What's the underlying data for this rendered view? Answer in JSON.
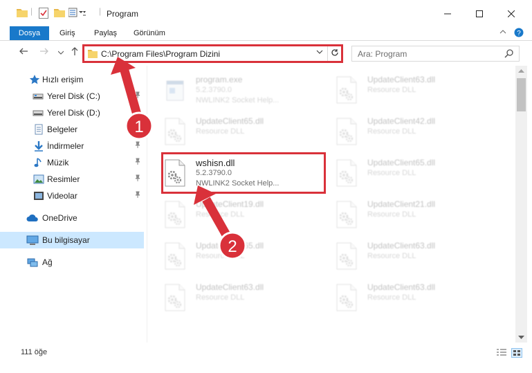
{
  "window": {
    "title": "Program",
    "minimize_icon": "minimize-icon",
    "maximize_icon": "maximize-icon",
    "close_icon": "close-icon"
  },
  "ribbon": {
    "tabs": [
      {
        "label": "Dosya",
        "active": true
      },
      {
        "label": "Giriş",
        "active": false
      },
      {
        "label": "Paylaş",
        "active": false
      },
      {
        "label": "Görünüm",
        "active": false
      }
    ],
    "accent": "#1979ca"
  },
  "nav": {
    "address": "C:\\Program Files\\Program Dizini",
    "search_placeholder": "Ara: Program"
  },
  "sidebar": {
    "items": [
      {
        "label": "Hızlı erişim",
        "icon": "star-icon"
      },
      {
        "label": "Yerel Disk (C:)",
        "icon": "drive-icon"
      },
      {
        "label": "Yerel Disk (D:)",
        "icon": "drive-icon"
      },
      {
        "label": "Belgeler",
        "icon": "documents-icon"
      },
      {
        "label": "İndirmeler",
        "icon": "download-icon"
      },
      {
        "label": "Müzik",
        "icon": "music-icon"
      },
      {
        "label": "Resimler",
        "icon": "pictures-icon"
      },
      {
        "label": "Videolar",
        "icon": "videos-icon"
      },
      {
        "label": "OneDrive",
        "icon": "cloud-icon"
      },
      {
        "label": "Bu bilgisayar",
        "icon": "computer-icon"
      },
      {
        "label": "Ağ",
        "icon": "network-icon"
      }
    ]
  },
  "files": [
    {
      "name": "program.exe",
      "line1": "5.2.3790.0",
      "line2": "NWLINK2 Socket Help...",
      "faded": true
    },
    {
      "name": "UpdateClient63.dll",
      "line1": "Resource DLL",
      "line2": "",
      "faded": true
    },
    {
      "name": "UpdateClient65.dll",
      "line1": "Resource DLL",
      "line2": "",
      "faded": true
    },
    {
      "name": "UpdateClient42.dll",
      "line1": "Resource DLL",
      "line2": "",
      "faded": true
    },
    {
      "name": "wshisn.dll",
      "line1": "5.2.3790.0",
      "line2": "NWLINK2 Socket Help...",
      "faded": false
    },
    {
      "name": "UpdateClient65.dll",
      "line1": "Resource DLL",
      "line2": "",
      "faded": true
    },
    {
      "name": "UpdateClient19.dll",
      "line1": "Resource DLL",
      "line2": "",
      "faded": true
    },
    {
      "name": "UpdateClient21.dll",
      "line1": "Resource DLL",
      "line2": "",
      "faded": true
    },
    {
      "name": "UpdateClient65.dll",
      "line1": "Resource DLL",
      "line2": "",
      "faded": true
    },
    {
      "name": "UpdateClient63.dll",
      "line1": "Resource DLL",
      "line2": "",
      "faded": true
    },
    {
      "name": "UpdateClient63.dll",
      "line1": "Resource DLL",
      "line2": "",
      "faded": true
    },
    {
      "name": "UpdateClient63.dll",
      "line1": "Resource DLL",
      "line2": "",
      "faded": true
    }
  ],
  "status": {
    "item_count": "111 öğe"
  },
  "annotations": {
    "callout_1": "1",
    "callout_2": "2",
    "color": "#d9313a"
  }
}
